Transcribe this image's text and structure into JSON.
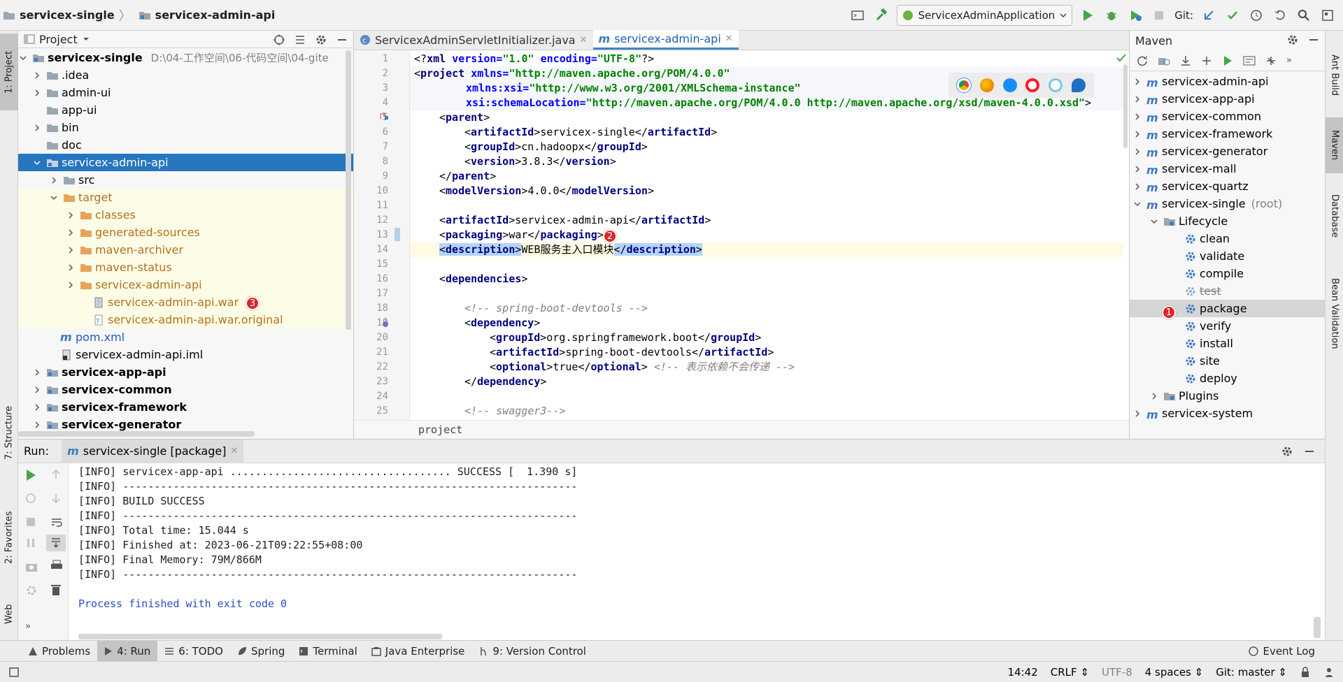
{
  "navbar": {
    "crumbs": [
      "servicex-single",
      "servicex-admin-api"
    ],
    "run_config": "ServicexAdminApplication",
    "git_label": "Git:"
  },
  "left_stripe": {
    "tabs": [
      "1: Project",
      "7: Structure",
      "2: Favorites",
      "Web"
    ]
  },
  "right_stripe": {
    "tabs": [
      "Ant Build",
      "Maven",
      "Database",
      "Bean Validation"
    ]
  },
  "project_panel": {
    "title": "Project",
    "rows": [
      {
        "label": "servicex-single",
        "extra": "D:\\04-工作空间\\06-代码空间\\04-gite"
      },
      {
        "label": ".idea"
      },
      {
        "label": "admin-ui"
      },
      {
        "label": "app-ui"
      },
      {
        "label": "bin"
      },
      {
        "label": "doc"
      },
      {
        "label": "servicex-admin-api"
      },
      {
        "label": "src"
      },
      {
        "label": "target"
      },
      {
        "label": "classes"
      },
      {
        "label": "generated-sources"
      },
      {
        "label": "maven-archiver"
      },
      {
        "label": "maven-status"
      },
      {
        "label": "servicex-admin-api"
      },
      {
        "label": "servicex-admin-api.war"
      },
      {
        "label": "servicex-admin-api.war.original"
      },
      {
        "label": "pom.xml"
      },
      {
        "label": "servicex-admin-api.iml"
      },
      {
        "label": "servicex-app-api"
      },
      {
        "label": "servicex-common"
      },
      {
        "label": "servicex-framework"
      },
      {
        "label": "servicex-generator"
      }
    ]
  },
  "editor": {
    "tabs": [
      "ServicexAdminServletInitializer.java",
      "servicex-admin-api"
    ],
    "line_numbers": [
      "1",
      "2",
      "3",
      "4",
      "5",
      "6",
      "7",
      "8",
      "9",
      "10",
      "11",
      "12",
      "13",
      "14",
      "15",
      "16",
      "17",
      "18",
      "19",
      "20",
      "21",
      "22",
      "23",
      "24",
      "25"
    ],
    "lines": {
      "l1_a": "<?",
      "l1_b": "xml ",
      "l1_c": "version=",
      "l1_d": "\"1.0\" ",
      "l1_e": "encoding=",
      "l1_f": "\"UTF-8\"",
      "l1_g": "?>",
      "l2_a": "<",
      "l2_b": "project ",
      "l2_c": "xmlns=",
      "l2_d": "\"http://maven.apache.org/POM/4.0.0\"",
      "l3_c": "xmlns:xsi=",
      "l3_d": "\"http://www.w3.org/2001/XMLSchema-instance\"",
      "l4_c": "xsi:schemaLocation=",
      "l4_d": "\"http://maven.apache.org/POM/4.0.0 http://maven.apache.org/xsd/maven-4.0.0.xsd\"",
      "l4_e": ">",
      "l5": "parent",
      "l6_tag": "artifactId",
      "l6_val": "servicex-single",
      "l7_tag": "groupId",
      "l7_val": "cn.hadoopx",
      "l8_tag": "version",
      "l8_val": "3.8.3",
      "l9": "parent",
      "l10_tag": "modelVersion",
      "l10_val": "4.0.0",
      "l12_tag": "artifactId",
      "l12_val": "servicex-admin-api",
      "l13_tag": "packaging",
      "l13_val": "war",
      "l14_tag": "description",
      "l14_val": "WEB服务主入口模块",
      "l16": "dependencies",
      "l18": "<!-- spring-boot-devtools -->",
      "l19": "dependency",
      "l20_tag": "groupId",
      "l20_val": "org.springframework.boot",
      "l21_tag": "artifactId",
      "l21_val": "spring-boot-devtools",
      "l22_tag": "optional",
      "l22_val": "true",
      "l22_cm": "<!-- 表示依赖不会传递 -->",
      "l23": "dependency",
      "l25": "<!-- swagger3-->"
    },
    "breadcrumb": "project"
  },
  "maven_panel": {
    "title": "Maven",
    "rows": [
      {
        "label": "servicex-admin-api"
      },
      {
        "label": "servicex-app-api"
      },
      {
        "label": "servicex-common"
      },
      {
        "label": "servicex-framework"
      },
      {
        "label": "servicex-generator"
      },
      {
        "label": "servicex-mall"
      },
      {
        "label": "servicex-quartz"
      },
      {
        "label": "servicex-single",
        "extra": "(root)"
      },
      {
        "label": "Lifecycle"
      },
      {
        "label": "clean"
      },
      {
        "label": "validate"
      },
      {
        "label": "compile"
      },
      {
        "label": "test"
      },
      {
        "label": "package"
      },
      {
        "label": "verify"
      },
      {
        "label": "install"
      },
      {
        "label": "site"
      },
      {
        "label": "deploy"
      },
      {
        "label": "Plugins"
      },
      {
        "label": "servicex-system"
      }
    ]
  },
  "run_panel": {
    "label": "Run:",
    "tab": "servicex-single [package]",
    "console": [
      "[INFO] servicex-app-api ................................... SUCCESS [  1.390 s]",
      "[INFO] ------------------------------------------------------------------------",
      "[INFO] BUILD SUCCESS",
      "[INFO] ------------------------------------------------------------------------",
      "[INFO] Total time: 15.044 s",
      "[INFO] Finished at: 2023-06-21T09:22:55+08:00",
      "[INFO] Final Memory: 79M/866M",
      "[INFO] ------------------------------------------------------------------------",
      "Process finished with exit code 0"
    ]
  },
  "tool_tabs": {
    "problems": "Problems",
    "run": "4: Run",
    "todo": "6: TODO",
    "spring": "Spring",
    "terminal": "Terminal",
    "java_ee": "Java Enterprise",
    "vcs": "9: Version Control",
    "event_log": "Event Log"
  },
  "status_bar": {
    "position": "14:42",
    "line_sep": "CRLF",
    "encoding": "UTF-8",
    "indent": "4 spaces",
    "git": "Git: master"
  },
  "badges": [
    "1",
    "2",
    "3"
  ],
  "colors": {
    "selection": "#2675bf",
    "tag": "#000080",
    "attr_value": "#008000",
    "badge": "#d8262c",
    "link": "#4083c9"
  }
}
